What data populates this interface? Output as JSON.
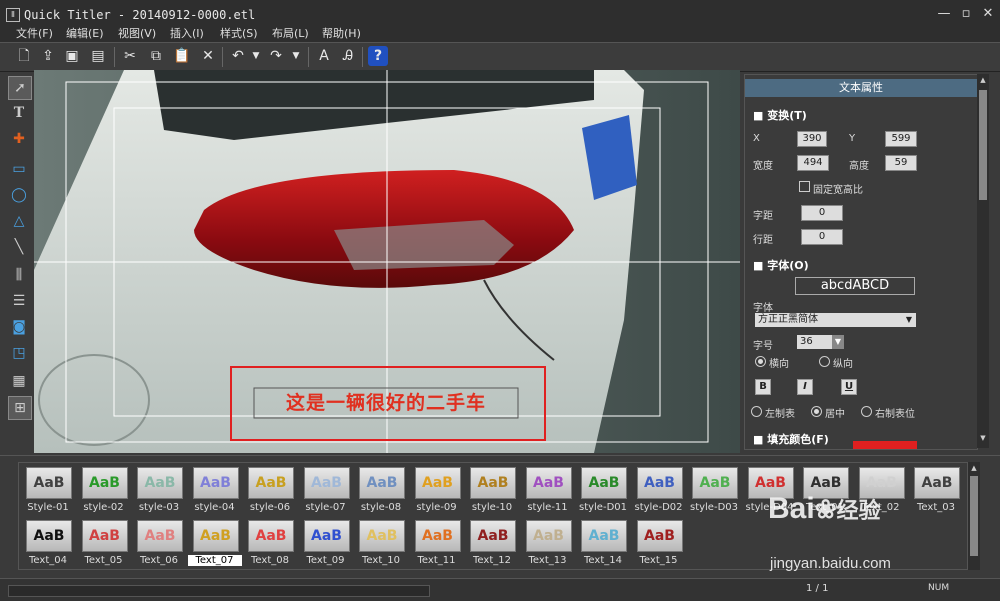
{
  "window": {
    "title": "Quick Titler - 20140912-0000.etl",
    "app_icon": "Ⅱ"
  },
  "menu": [
    "文件(F)",
    "编辑(E)",
    "视图(V)",
    "插入(I)",
    "样式(S)",
    "布局(L)",
    "帮助(H)"
  ],
  "toolbar_icons": [
    "new-file-icon",
    "open-file-icon",
    "save-icon",
    "save-all-icon",
    "cut-icon",
    "copy-icon",
    "paste-icon",
    "delete-icon",
    "undo-icon",
    "undo-dropdown-icon",
    "redo-icon",
    "redo-dropdown-icon",
    "text-style-icon",
    "text-effect-icon",
    "help-icon"
  ],
  "left_tools": [
    "select-tool-icon",
    "text-tool-icon",
    "crosshair-tool-icon",
    "rectangle-tool-icon",
    "ellipse-tool-icon",
    "triangle-tool-icon",
    "line-tool-icon",
    "align-tool-icon",
    "distribute-tool-icon",
    "center-tool-icon",
    "arrange-tool-icon",
    "grid-tool-icon",
    "table-tool-icon"
  ],
  "canvas": {
    "caption": "这是一辆很好的二手车",
    "caption_color": "#e03020",
    "highlight_color": "#e02020"
  },
  "panel": {
    "title": "文本属性",
    "transform": {
      "heading": "变换(T)",
      "x_label": "X",
      "x_value": "390",
      "y_label": "Y",
      "y_value": "599",
      "width_label": "宽度",
      "width_value": "494",
      "height_label": "高度",
      "height_value": "59",
      "lock_label": "固定宽高比",
      "spacing_label": "字距",
      "spacing_value": "0",
      "leading_label": "行距",
      "leading_value": "0"
    },
    "font": {
      "heading": "字体(O)",
      "preview": "abcdABCD",
      "family_label": "字体",
      "family_value": "方正正黑简体",
      "size_label": "字号",
      "size_value": "36",
      "horizontal": "横向",
      "vertical": "纵向",
      "bold": "B",
      "italic": "I",
      "underline": "U",
      "left_tab": "左制表",
      "center": "居中",
      "right_tab": "右制表位"
    },
    "fill": {
      "heading": "填充颜色(F)",
      "color": "#e02020"
    }
  },
  "styles": [
    {
      "name": "Style-01",
      "color": "#404040"
    },
    {
      "name": "style-02",
      "color": "#2a9a2a"
    },
    {
      "name": "style-03",
      "color": "#8ab8a8"
    },
    {
      "name": "style-04",
      "color": "#8080d8"
    },
    {
      "name": "style-06",
      "color": "#c8a020"
    },
    {
      "name": "style-07",
      "color": "#a0b8d8"
    },
    {
      "name": "style-08",
      "color": "#7090c0"
    },
    {
      "name": "style-09",
      "color": "#e0a020"
    },
    {
      "name": "style-10",
      "color": "#b08020"
    },
    {
      "name": "style-11",
      "color": "#a050c0"
    },
    {
      "name": "style-D01",
      "color": "#2a8a2a"
    },
    {
      "name": "style-D02",
      "color": "#4060c0"
    },
    {
      "name": "style-D03",
      "color": "#50b050"
    },
    {
      "name": "style-D04",
      "color": "#d03030"
    },
    {
      "name": "Text_01",
      "color": "#303030"
    },
    {
      "name": "Text_02",
      "color": "#d0d0d0"
    },
    {
      "name": "Text_03",
      "color": "#404040"
    },
    {
      "name": "Text_04",
      "color": "#101010"
    },
    {
      "name": "Text_05",
      "color": "#d04040"
    },
    {
      "name": "Text_06",
      "color": "#e08080"
    },
    {
      "name": "Text_07",
      "color": "#d0a020"
    },
    {
      "name": "Text_08",
      "color": "#e04040"
    },
    {
      "name": "Text_09",
      "color": "#3050d0"
    },
    {
      "name": "Text_10",
      "color": "#e0c060"
    },
    {
      "name": "Text_11",
      "color": "#e07020"
    },
    {
      "name": "Text_12",
      "color": "#902020"
    },
    {
      "name": "Text_13",
      "color": "#c0b090"
    },
    {
      "name": "Text_14",
      "color": "#60b0d0"
    },
    {
      "name": "Text_15",
      "color": "#a02020"
    }
  ],
  "style_thumb_text": "AaB",
  "selected_style": "Text_07",
  "status": {
    "page": "1 / 1",
    "num": "NUM"
  },
  "watermark": {
    "brand": "Bai",
    "brand2": "经验",
    "url": "jingyan.baidu.com"
  }
}
